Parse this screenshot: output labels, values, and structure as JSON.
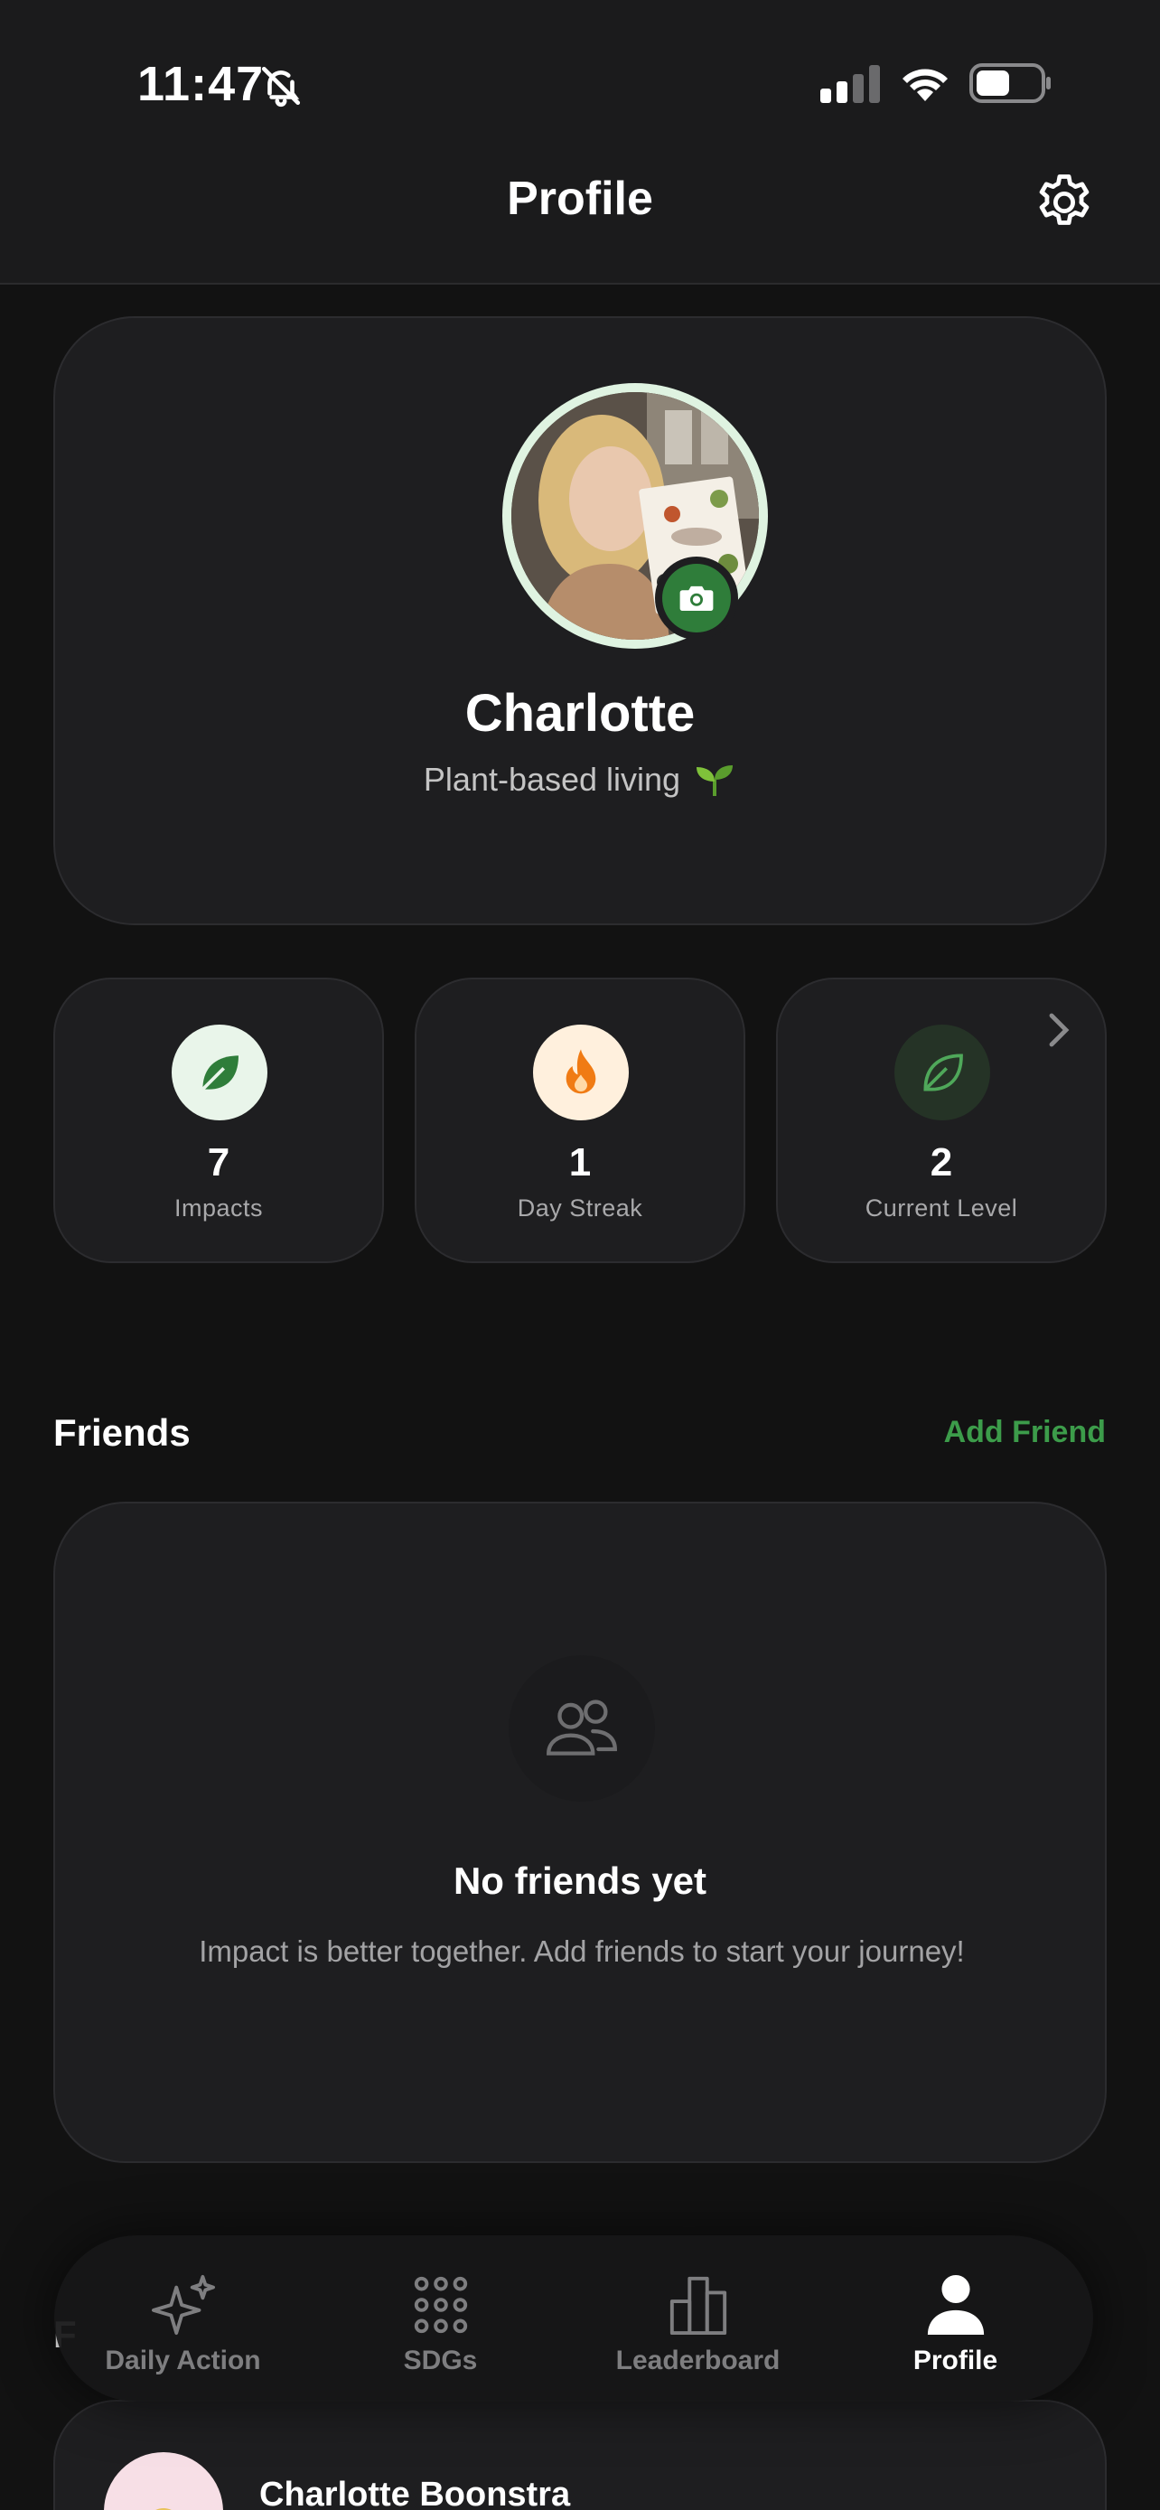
{
  "status_bar": {
    "time": "11:47",
    "bell_icon": "bell-slash-icon",
    "signal_icon": "cellular-signal-icon",
    "wifi_icon": "wifi-icon",
    "battery_icon": "battery-icon"
  },
  "header": {
    "title": "Profile",
    "settings_icon": "gear-icon"
  },
  "profile": {
    "name": "Charlotte",
    "bio": "Plant-based living",
    "bio_icon": "seedling-icon",
    "avatar_badge_icon": "camera-icon",
    "ring_color": "#dff3e1"
  },
  "stats": [
    {
      "value": "7",
      "label": "Impacts",
      "icon": "leaf-icon",
      "circle_color": "#e9f5ea",
      "icon_color": "#2f7d3a"
    },
    {
      "value": "1",
      "label": "Day Streak",
      "icon": "flame-icon",
      "circle_color": "#fff0dd",
      "icon_color": "#f07b14"
    },
    {
      "value": "2",
      "label": "Current Level",
      "icon": "leaf-outline-icon",
      "circle_color": "#253326",
      "icon_color": "#4fa85a"
    }
  ],
  "friends": {
    "title": "Friends",
    "add_label": "Add Friend",
    "empty_icon": "people-icon",
    "empty_title": "No friends yet",
    "empty_text": "Impact is better together. Add friends to start your journey!"
  },
  "bottom_section": {
    "title_peek": "F",
    "member_name": "Charlotte Boonstra"
  },
  "tabs": [
    {
      "label": "Daily Action",
      "icon": "sparkles-icon",
      "active": false
    },
    {
      "label": "SDGs",
      "icon": "grid-dots-icon",
      "active": false
    },
    {
      "label": "Leaderboard",
      "icon": "bar-chart-icon",
      "active": false
    },
    {
      "label": "Profile",
      "icon": "person-icon",
      "active": true
    }
  ],
  "colors": {
    "background": "#121212",
    "card": "#1e1e20",
    "accent_green": "#3c9c4a"
  }
}
